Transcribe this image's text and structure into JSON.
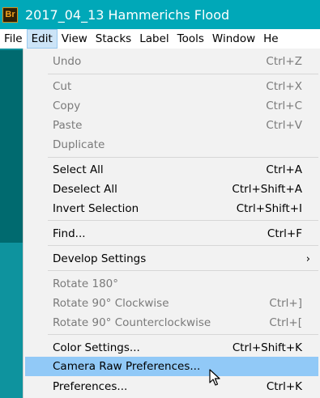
{
  "window": {
    "title": "2017_04_13 Hammerichs Flood",
    "app_icon_text": "Br"
  },
  "menubar": [
    "File",
    "Edit",
    "View",
    "Stacks",
    "Label",
    "Tools",
    "Window",
    "He"
  ],
  "menu": {
    "undo": {
      "label": "Undo",
      "shortcut": "Ctrl+Z"
    },
    "cut": {
      "label": "Cut",
      "shortcut": "Ctrl+X"
    },
    "copy": {
      "label": "Copy",
      "shortcut": "Ctrl+C"
    },
    "paste": {
      "label": "Paste",
      "shortcut": "Ctrl+V"
    },
    "duplicate": {
      "label": "Duplicate"
    },
    "select_all": {
      "label": "Select All",
      "shortcut": "Ctrl+A"
    },
    "deselect_all": {
      "label": "Deselect All",
      "shortcut": "Ctrl+Shift+A"
    },
    "invert_selection": {
      "label": "Invert Selection",
      "shortcut": "Ctrl+Shift+I"
    },
    "find": {
      "label": "Find...",
      "shortcut": "Ctrl+F"
    },
    "develop_settings": {
      "label": "Develop Settings",
      "arrow": "›"
    },
    "rotate_180": {
      "label": "Rotate 180°"
    },
    "rotate_cw": {
      "label": "Rotate 90° Clockwise",
      "shortcut": "Ctrl+]"
    },
    "rotate_ccw": {
      "label": "Rotate 90° Counterclockwise",
      "shortcut": "Ctrl+["
    },
    "color_settings": {
      "label": "Color Settings...",
      "shortcut": "Ctrl+Shift+K"
    },
    "camera_raw_prefs": {
      "label": "Camera Raw Preferences..."
    },
    "preferences": {
      "label": "Preferences...",
      "shortcut": "Ctrl+K"
    }
  }
}
